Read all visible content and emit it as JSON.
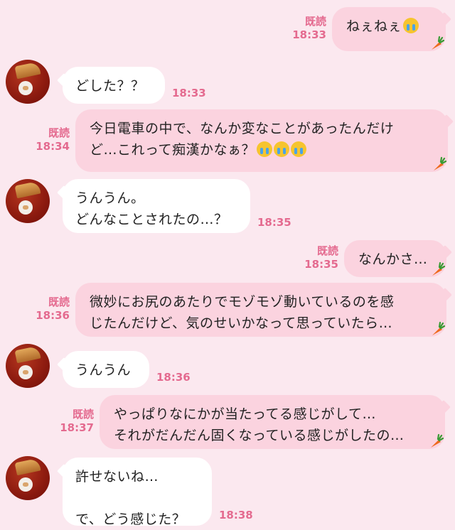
{
  "messages": [
    {
      "dir": "out",
      "read": "既読",
      "time": "18:33",
      "text": "ねぇねぇ",
      "emoji": 1,
      "carrot": true
    },
    {
      "dir": "in",
      "time": "18:33",
      "text": "どした？？"
    },
    {
      "dir": "out",
      "read": "既読",
      "time": "18:34",
      "text": "今日電車の中で、なんか変なことがあったんだけ\nど…これって痴漢かなぁ？",
      "emoji": 3,
      "carrot": true
    },
    {
      "dir": "in",
      "time": "18:35",
      "text": "うんうん。\nどんなことされたの…？"
    },
    {
      "dir": "out",
      "read": "既読",
      "time": "18:35",
      "text": "なんかさ…",
      "carrot": true
    },
    {
      "dir": "out",
      "read": "既読",
      "time": "18:36",
      "text": "微妙にお尻のあたりでモゾモゾ動いているのを感\nじたんだけど、気のせいかなって思っていたら…",
      "carrot": true
    },
    {
      "dir": "in",
      "time": "18:36",
      "text": "うんうん"
    },
    {
      "dir": "out",
      "read": "既読",
      "time": "18:37",
      "text": "やっぱりなにかが当たってる感じがして…\nそれがだんだん固くなっている感じがしたの…",
      "carrot": true
    },
    {
      "dir": "in",
      "time": "18:38",
      "text": "許せないね…\n\nで、どう感じた？"
    }
  ],
  "icons": {
    "avatar": "bear-avatar",
    "carrot": "carrot-icon",
    "emoji": "crying-face-emoji"
  },
  "colors": {
    "background": "#fbe8ef",
    "outgoing_bubble": "#fbd3df",
    "incoming_bubble": "#ffffff",
    "timestamp": "#e46a8f"
  }
}
